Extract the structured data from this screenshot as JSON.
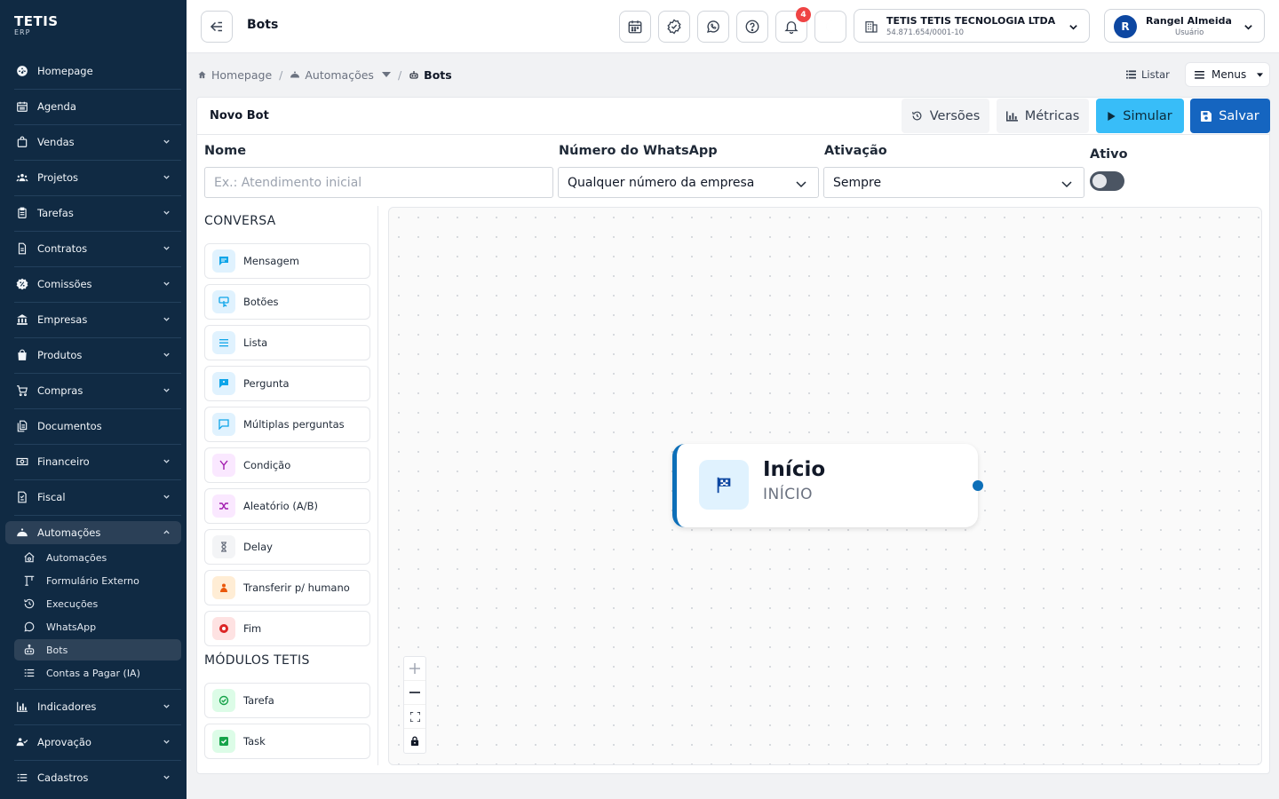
{
  "brand": {
    "name": "TETIS",
    "sub": "ERP"
  },
  "sidebar": {
    "items": [
      {
        "label": "Homepage",
        "icon": "dashboard-icon",
        "chevron": false
      },
      {
        "label": "Agenda",
        "icon": "calendar-icon",
        "chevron": false
      },
      {
        "label": "Vendas",
        "icon": "bag-icon",
        "chevron": true
      },
      {
        "label": "Projetos",
        "icon": "users-icon",
        "chevron": true
      },
      {
        "label": "Tarefas",
        "icon": "clipboard-icon",
        "chevron": true
      },
      {
        "label": "Contratos",
        "icon": "document-icon",
        "chevron": true
      },
      {
        "label": "Comissões",
        "icon": "percent-badge-icon",
        "chevron": true
      },
      {
        "label": "Empresas",
        "icon": "bank-icon",
        "chevron": true
      },
      {
        "label": "Produtos",
        "icon": "box-icon",
        "chevron": true
      },
      {
        "label": "Compras",
        "icon": "cart-icon",
        "chevron": true
      },
      {
        "label": "Documentos",
        "icon": "files-icon",
        "chevron": false
      },
      {
        "label": "Financeiro",
        "icon": "money-icon",
        "chevron": true
      },
      {
        "label": "Fiscal",
        "icon": "receipt-icon",
        "chevron": true
      },
      {
        "label": "Automações",
        "icon": "robot-icon",
        "chevron": true
      }
    ],
    "automacoes_sub": [
      {
        "label": "Automações",
        "icon": "home-gear-icon"
      },
      {
        "label": "Formulário Externo",
        "icon": "form-icon"
      },
      {
        "label": "Execuções",
        "icon": "history-icon"
      },
      {
        "label": "WhatsApp",
        "icon": "whatsapp-icon"
      },
      {
        "label": "Bots",
        "icon": "bot-icon"
      },
      {
        "label": "Contas a Pagar (IA)",
        "icon": "list-icon"
      }
    ],
    "bottom_items": [
      {
        "label": "Indicadores",
        "icon": "chart-icon"
      },
      {
        "label": "Aprovação",
        "icon": "approval-icon"
      },
      {
        "label": "Cadastros",
        "icon": "list-icon"
      }
    ]
  },
  "topbar": {
    "title": "Bots",
    "notifications_count": "4",
    "company_name": "TETIS TETIS TECNOLOGIA LTDA",
    "company_cnpj": "54.871.654/0001-10",
    "user_initial": "R",
    "user_name": "Rangel Almeida",
    "user_role": "Usuário"
  },
  "breadcrumb": {
    "home": "Homepage",
    "parent": "Automações",
    "current": "Bots",
    "listar": "Listar",
    "menus": "Menus"
  },
  "editor": {
    "title": "Novo Bot",
    "versions_label": "Versões",
    "metrics_label": "Métricas",
    "simulate_label": "Simular",
    "save_label": "Salvar",
    "name_label": "Nome",
    "name_placeholder": "Ex.: Atendimento inicial",
    "whatsapp_label": "Número do WhatsApp",
    "whatsapp_value": "Qualquer número da empresa",
    "activation_label": "Ativação",
    "activation_value": "Sempre",
    "active_label": "Ativo",
    "active": false
  },
  "palette": {
    "conversa_title": "CONVERSA",
    "conversa_items": [
      {
        "label": "Mensagem",
        "icon": "message-icon",
        "color": "#0ea5e9",
        "bg": "#e0f2fe"
      },
      {
        "label": "Botões",
        "icon": "buttons-icon",
        "color": "#0ea5e9",
        "bg": "#e0f2fe"
      },
      {
        "label": "Lista",
        "icon": "list-icon",
        "color": "#0ea5e9",
        "bg": "#e0f2fe"
      },
      {
        "label": "Pergunta",
        "icon": "question-icon",
        "color": "#0ea5e9",
        "bg": "#e0f2fe"
      },
      {
        "label": "Múltiplas perguntas",
        "icon": "multi-question-icon",
        "color": "#0ea5e9",
        "bg": "#e0f2fe"
      },
      {
        "label": "Condição",
        "icon": "branch-icon",
        "color": "#a21caf",
        "bg": "#fae8ff"
      },
      {
        "label": "Aleatório (A/B)",
        "icon": "shuffle-icon",
        "color": "#a21caf",
        "bg": "#fae8ff"
      },
      {
        "label": "Delay",
        "icon": "hourglass-icon",
        "color": "#6b7280",
        "bg": "#f3f4f6"
      },
      {
        "label": "Transferir p/ humano",
        "icon": "person-icon",
        "color": "#ea580c",
        "bg": "#ffedd5"
      },
      {
        "label": "Fim",
        "icon": "stop-icon",
        "color": "#dc2626",
        "bg": "#fee2e2"
      }
    ],
    "modulos_title": "MÓDULOS TETIS",
    "modulos_items": [
      {
        "label": "Tarefa",
        "icon": "check-circle-icon",
        "color": "#16a34a",
        "bg": "#dcfce7"
      },
      {
        "label": "Task",
        "icon": "check-square-icon",
        "color": "#16a34a",
        "bg": "#dcfce7"
      }
    ]
  },
  "node": {
    "title": "Início",
    "subtitle": "INÍCIO",
    "icon": "flag-icon"
  },
  "colors": {
    "sidebar": "#102a43",
    "primary": "#1565c0",
    "simulate": "#38bdf8",
    "node_accent": "#0d6fb8"
  }
}
